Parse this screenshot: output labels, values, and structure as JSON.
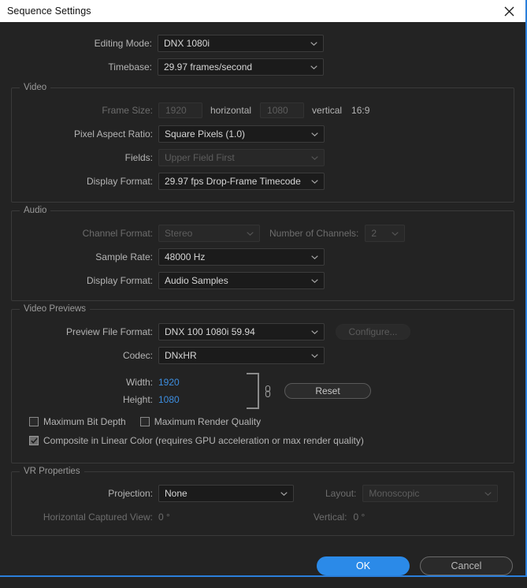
{
  "window": {
    "title": "Sequence Settings",
    "close_icon": "close-icon",
    "accent_color": "#2b8ae8",
    "link_color": "#3d8ee0",
    "background": "#232323"
  },
  "top": {
    "editing_mode": {
      "label": "Editing Mode:",
      "value": "DNX 1080i"
    },
    "timebase": {
      "label": "Timebase:",
      "value": "29.97  frames/second"
    }
  },
  "video": {
    "title": "Video",
    "frame_size": {
      "label": "Frame Size:",
      "horizontal_value": "1920",
      "horizontal_label": "horizontal",
      "vertical_value": "1080",
      "vertical_label": "vertical",
      "aspect_ratio": "16:9"
    },
    "pixel_aspect_ratio": {
      "label": "Pixel Aspect Ratio:",
      "value": "Square Pixels (1.0)"
    },
    "fields": {
      "label": "Fields:",
      "value": "Upper Field First"
    },
    "display_format": {
      "label": "Display Format:",
      "value": "29.97 fps Drop-Frame Timecode"
    }
  },
  "audio": {
    "title": "Audio",
    "channel_format": {
      "label": "Channel Format:",
      "value": "Stereo"
    },
    "number_of_channels": {
      "label": "Number of Channels:",
      "value": "2"
    },
    "sample_rate": {
      "label": "Sample Rate:",
      "value": "48000 Hz"
    },
    "display_format": {
      "label": "Display Format:",
      "value": "Audio Samples"
    }
  },
  "video_previews": {
    "title": "Video Previews",
    "preview_file_format": {
      "label": "Preview File Format:",
      "value": "DNX 100 1080i 59.94"
    },
    "configure_button": "Configure...",
    "codec": {
      "label": "Codec:",
      "value": "DNxHR"
    },
    "width": {
      "label": "Width:",
      "value": "1920"
    },
    "height": {
      "label": "Height:",
      "value": "1080"
    },
    "link_icon": "chain-link-icon",
    "reset_button": "Reset",
    "maximum_bit_depth": {
      "label": "Maximum Bit Depth",
      "checked": false
    },
    "maximum_render_quality": {
      "label": "Maximum Render Quality",
      "checked": false
    },
    "composite_linear_color": {
      "label": "Composite in Linear Color (requires GPU acceleration or max render quality)",
      "checked": true
    }
  },
  "vr_properties": {
    "title": "VR Properties",
    "projection": {
      "label": "Projection:",
      "value": "None"
    },
    "layout": {
      "label": "Layout:",
      "value": "Monoscopic"
    },
    "horizontal_captured_view": {
      "label": "Horizontal Captured View:",
      "value": "0 °"
    },
    "vertical": {
      "label": "Vertical:",
      "value": "0 °"
    }
  },
  "footer": {
    "ok_label": "OK",
    "cancel_label": "Cancel"
  }
}
